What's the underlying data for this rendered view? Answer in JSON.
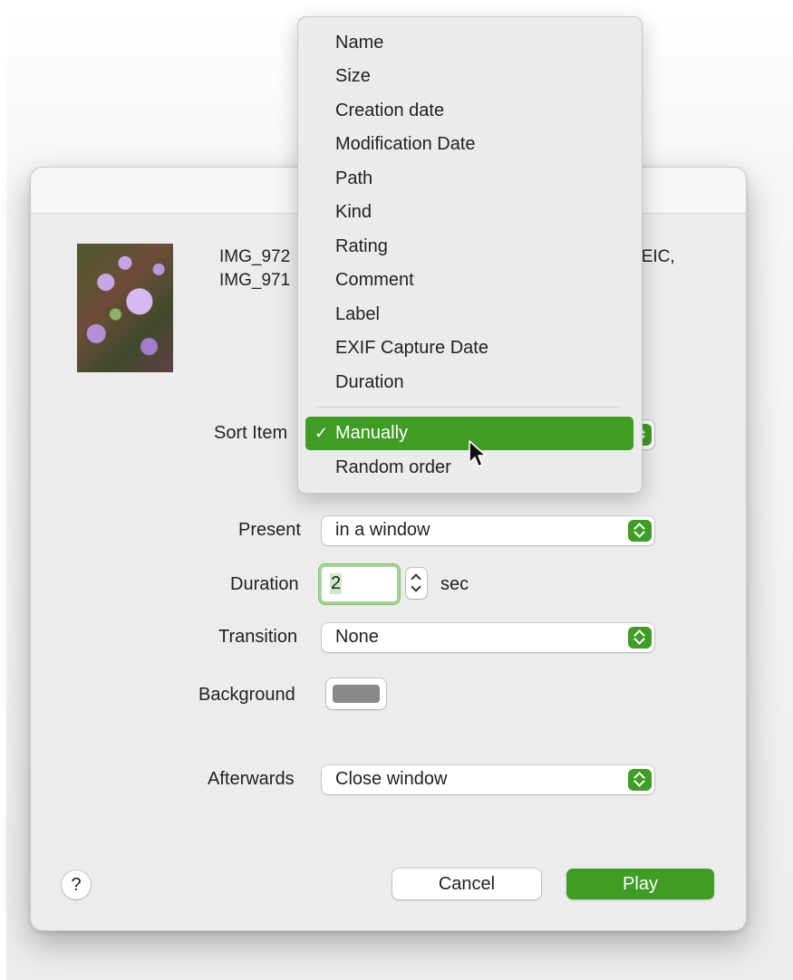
{
  "dialog": {
    "filenames_line1": "IMG_972",
    "filenames_line2": "IMG_971",
    "filenames_tail": "HEIC,"
  },
  "sort": {
    "label": "Sort Item"
  },
  "present": {
    "label": "Present",
    "value": "in a window"
  },
  "duration": {
    "label": "Duration",
    "value": "2",
    "unit": "sec"
  },
  "transition": {
    "label": "Transition",
    "value": "None"
  },
  "background": {
    "label": "Background",
    "color": "#888888"
  },
  "afterwards": {
    "label": "Afterwards",
    "value": "Close window"
  },
  "buttons": {
    "help": "?",
    "cancel": "Cancel",
    "play": "Play"
  },
  "menu": {
    "items": [
      "Name",
      "Size",
      "Creation date",
      "Modification Date",
      "Path",
      "Kind",
      "Rating",
      "Comment",
      "Label",
      "EXIF Capture Date",
      "Duration"
    ],
    "selected": "Manually",
    "selected_check": "✓",
    "after": "Random order"
  },
  "colors": {
    "accent": "#3f9c25"
  }
}
